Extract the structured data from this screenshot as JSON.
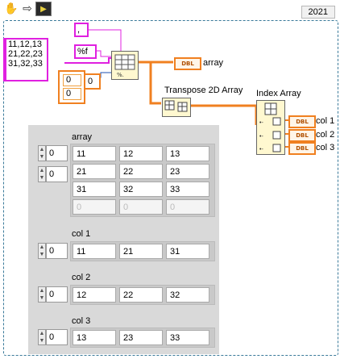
{
  "toolbar": {
    "icons": [
      "hand-icon",
      "arrow-right-icon",
      "run-icon"
    ]
  },
  "version_label": "2021",
  "diagram": {
    "string_constant": "11,12,13\n21,22,23\n31,32,33",
    "delimiter_constant": ",",
    "format_constant": "%f",
    "offset_values": [
      "0",
      "0"
    ],
    "offset_small": "0",
    "array_indicator_label": "array",
    "transpose_label": "Transpose 2D Array",
    "index_array_label": "Index Array",
    "dbl_tag": "DBL",
    "col_labels": [
      "col 1",
      "col 2",
      "col 3"
    ]
  },
  "front_panel": {
    "array": {
      "label": "array",
      "indices": [
        "0",
        "0"
      ],
      "rows": [
        [
          "11",
          "12",
          "13"
        ],
        [
          "21",
          "22",
          "23"
        ],
        [
          "31",
          "32",
          "33"
        ],
        [
          "0",
          "0",
          "0"
        ]
      ]
    },
    "col1": {
      "label": "col 1",
      "index": "0",
      "values": [
        "11",
        "21",
        "31"
      ]
    },
    "col2": {
      "label": "col 2",
      "index": "0",
      "values": [
        "12",
        "22",
        "32"
      ]
    },
    "col3": {
      "label": "col 3",
      "index": "0",
      "values": [
        "13",
        "23",
        "33"
      ]
    }
  }
}
